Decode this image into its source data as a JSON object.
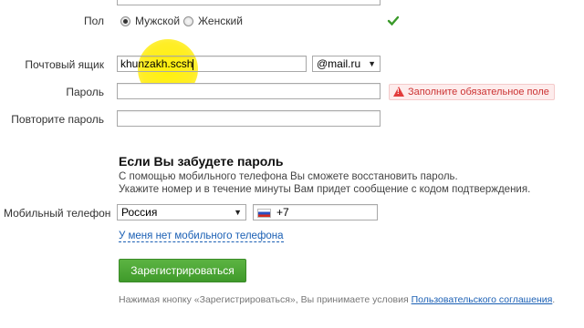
{
  "gender": {
    "label": "Пол",
    "male": "Мужской",
    "female": "Женский",
    "ok_icon": "check-icon"
  },
  "mailbox": {
    "label": "Почтовый ящик",
    "value": "khunzakh.sc",
    "value_tail": "sh",
    "domain": "@mail.ru"
  },
  "password": {
    "label": "Пароль",
    "error": "Заполните обязательное поле"
  },
  "repeat_password": {
    "label": "Повторите пароль"
  },
  "forgot": {
    "title": "Если Вы забудете пароль",
    "line1": "С помощью мобильного телефона Вы сможете восстановить пароль.",
    "line2": "Укажите номер и в течение минуты Вам придет сообщение с кодом подтверждения."
  },
  "phone": {
    "label": "Мобильный телефон",
    "country": "Россия",
    "prefix": "+7",
    "no_phone_link": "У меня нет мобильного телефона"
  },
  "register_button": "Зарегистрироваться",
  "terms": {
    "text": "Нажимая кнопку «Зарегистрироваться», Вы принимаете условия",
    "link": "Пользовательского соглашения",
    "end": "."
  },
  "colors": {
    "accent_green": "#4aa834",
    "error_red": "#cc3333",
    "link_blue": "#1a5fb4"
  }
}
